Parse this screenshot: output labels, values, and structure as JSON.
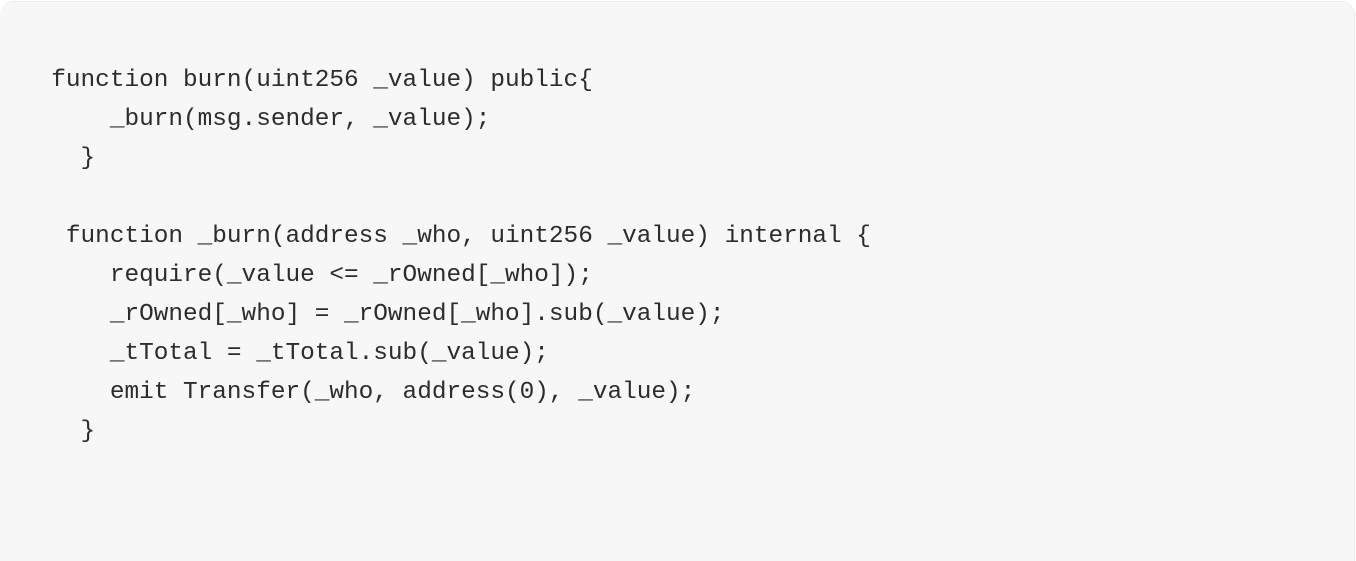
{
  "card": {
    "background_color": "#f7f7f7",
    "border_color": "#ececed",
    "text_color": "#2c2c2e"
  },
  "code": {
    "language": "solidity",
    "lines": [
      "  function burn(uint256 _value) public{",
      "      _burn(msg.sender, _value);",
      "    }",
      "",
      "   function _burn(address _who, uint256 _value) internal {",
      "      require(_value <= _rOwned[_who]);",
      "      _rOwned[_who] = _rOwned[_who].sub(_value);",
      "      _tTotal = _tTotal.sub(_value);",
      "      emit Transfer(_who, address(0), _value);",
      "    }"
    ]
  }
}
